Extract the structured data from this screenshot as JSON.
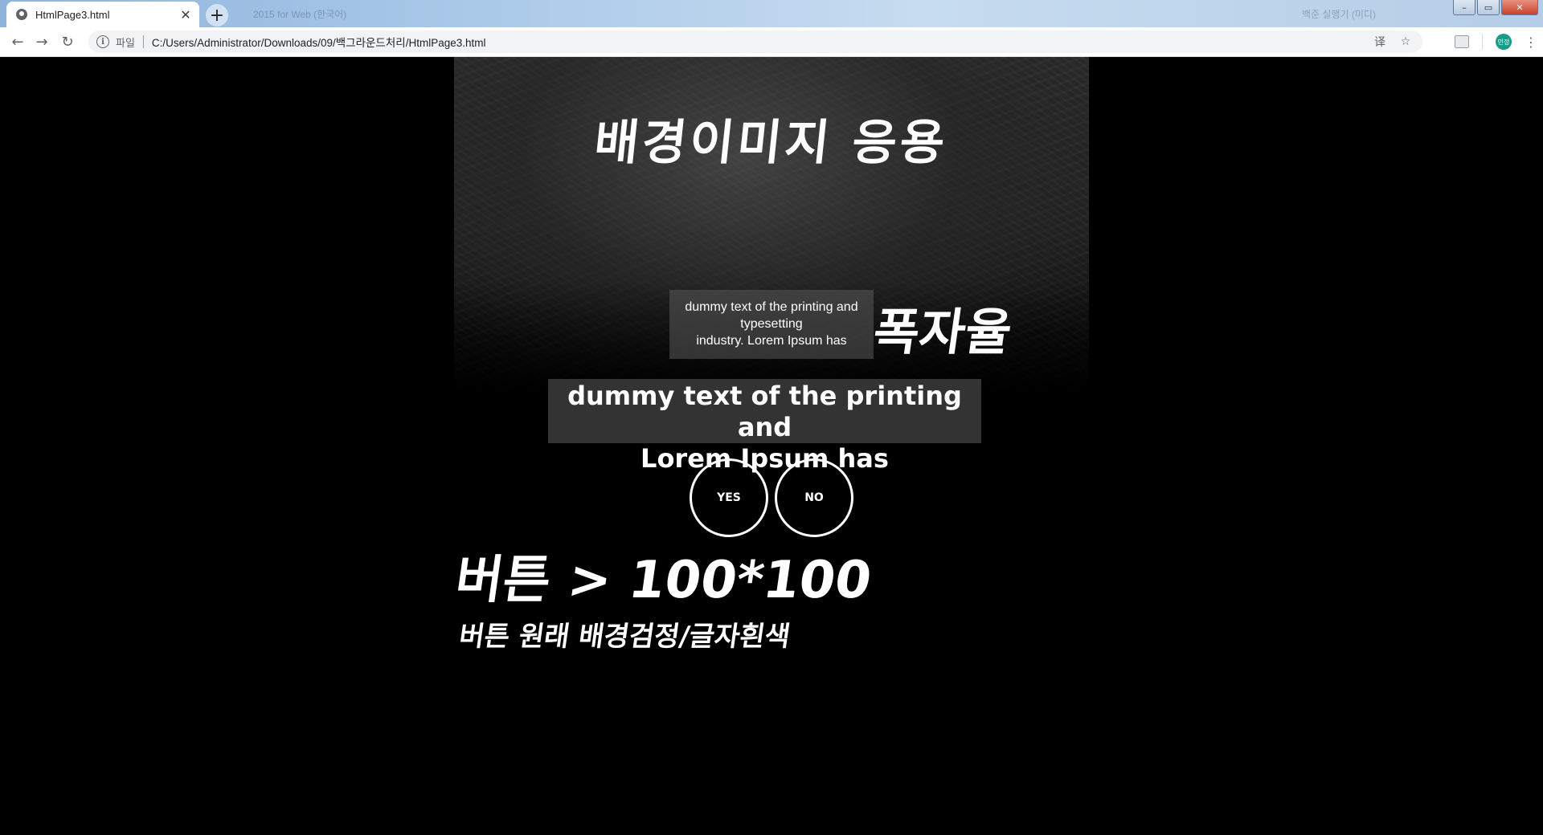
{
  "browser": {
    "tab": {
      "title": "HtmlPage3.html",
      "close_glyph": "✕",
      "favicon": "globe-icon"
    },
    "new_tab_glyph": "+",
    "ghost_tab_text": "2015 for Web (한국어)",
    "ghost_window_text": "백준 실행기 (미디)",
    "window_controls": {
      "minimize": "–",
      "restore": "▭",
      "close": "✕"
    },
    "nav": {
      "back": "←",
      "forward": "→",
      "reload": "↻"
    },
    "omnibox": {
      "info_glyph": "i",
      "scheme_label": "파일",
      "url": "C:/Users/Administrator/Downloads/09/백그라운드처리/HtmlPage3.html"
    },
    "right_icons": {
      "translate": "译",
      "bookmark": "☆",
      "avatar_text": "민정",
      "menu": "⋮"
    }
  },
  "page": {
    "hero_title": "배경이미지 응용",
    "small_box_lines": [
      "dummy text of the printing and",
      "typesetting",
      "industry. Lorem Ipsum has"
    ],
    "ratio_label": "폭자율",
    "big_box_lines": [
      "dummy text of the printing and",
      "Lorem Ipsum has"
    ],
    "buttons": {
      "yes": "YES",
      "no": "NO"
    },
    "note_line1": "버튼 > 100*100",
    "note_line2": "버튼 원래 배경검정/글자흰색"
  },
  "colors": {
    "page_background": "#000000",
    "small_box_bg": "#5a5a5a",
    "big_box_bg": "#333333",
    "text": "#ffffff"
  }
}
